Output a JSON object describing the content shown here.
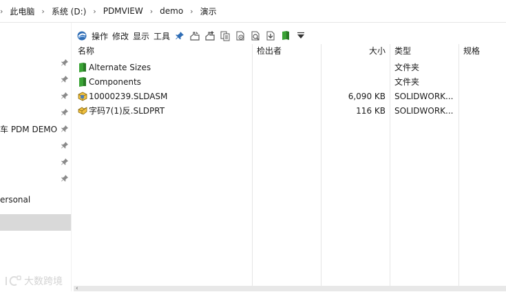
{
  "breadcrumbs": [
    "此电脑",
    "系统 (D:)",
    "PDMVIEW",
    "demo",
    "演示"
  ],
  "nav": {
    "items": [
      "车 PDM DEMO",
      "ersonal"
    ]
  },
  "toolbar": {
    "menus": [
      "操作",
      "修改",
      "显示",
      "工具"
    ]
  },
  "columns": {
    "name": "名称",
    "checked_out_by": "检出者",
    "size": "大小",
    "type": "类型",
    "spec": "规格"
  },
  "files": [
    {
      "name": "Alternate Sizes",
      "checked_out_by": "",
      "size": "",
      "type": "文件夹",
      "spec": "",
      "icon": "folder-icon"
    },
    {
      "name": "Components",
      "checked_out_by": "",
      "size": "",
      "type": "文件夹",
      "spec": "",
      "icon": "folder-icon"
    },
    {
      "name": "10000239.SLDASM",
      "checked_out_by": "",
      "size": "6,090 KB",
      "type": "SOLIDWORK...",
      "spec": "",
      "icon": "assembly-icon"
    },
    {
      "name": "字码7(1)反.SLDPRT",
      "checked_out_by": "",
      "size": "116 KB",
      "type": "SOLIDWORK...",
      "spec": "",
      "icon": "part-icon"
    }
  ],
  "watermark": {
    "text": "大数跨境"
  },
  "colors": {
    "folder": "#3aa335",
    "selected_nav": "#d9d9d9",
    "pin": "#8a8a8a"
  }
}
